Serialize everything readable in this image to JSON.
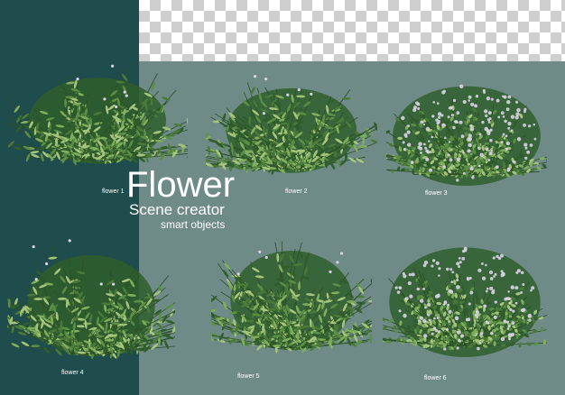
{
  "header": {
    "title": "Flower",
    "subtitle": "Scene creator",
    "tagline": "smart objects"
  },
  "colors": {
    "left_panel": "#1f4c4c",
    "right_panel": "#6f8b88",
    "foliage_dark": "#2f5e2c",
    "foliage_mid": "#5b8f45",
    "foliage_light": "#a3c57c",
    "blossom": "#d9d3e6"
  },
  "items": [
    {
      "label": "flower 1",
      "blossoms": false
    },
    {
      "label": "flower 2",
      "blossoms": false
    },
    {
      "label": "flower 3",
      "blossoms": true
    },
    {
      "label": "flower 4",
      "blossoms": false
    },
    {
      "label": "flower 5",
      "blossoms": false
    },
    {
      "label": "flower 6",
      "blossoms": true
    }
  ]
}
